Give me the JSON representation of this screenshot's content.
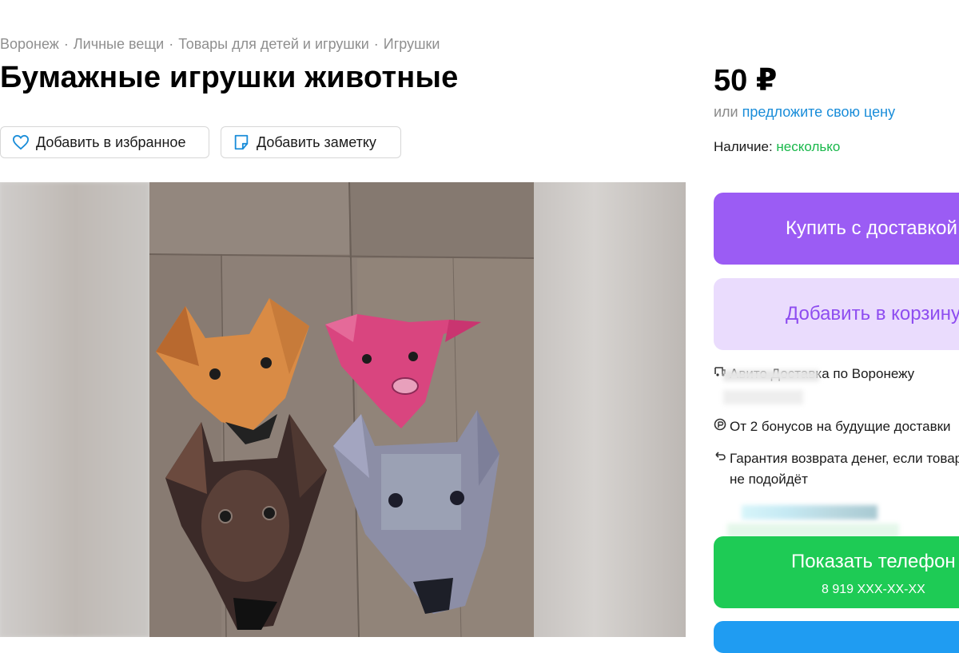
{
  "breadcrumb": [
    "Воронеж",
    "Личные вещи",
    "Товары для детей и игрушки",
    "Игрушки"
  ],
  "title": "Бумажные игрушки животные",
  "actions": {
    "favorite": "Добавить в избранное",
    "note": "Добавить заметку"
  },
  "price": "50 ₽",
  "offer": {
    "prefix": "или",
    "link": "предложите свою цену"
  },
  "stock": {
    "label": "Наличие:",
    "value": "несколько"
  },
  "buttons": {
    "buy": "Купить с доставкой",
    "cart": "Добавить в корзину",
    "phone": "Показать телефон",
    "phone_number": "8 919 XXX-XX-XX"
  },
  "features": {
    "delivery": "Авито Доставка по Воронежу",
    "bonus": "От 2 бонусов на будущие доставки",
    "return_line1": "Гарантия возврата денег, если товар",
    "return_line2": "не подойдёт"
  },
  "icons": [
    "heart-icon",
    "note-icon",
    "delivery-icon",
    "bonus-icon",
    "return-icon"
  ],
  "colors": {
    "buy": "#9b5cf4",
    "cart_bg": "#eadcfd",
    "cart_text": "#8e4df0",
    "phone": "#1ecb55",
    "link": "#1a8dd9",
    "stock": "#18b84a",
    "message": "#1f9cf2"
  }
}
